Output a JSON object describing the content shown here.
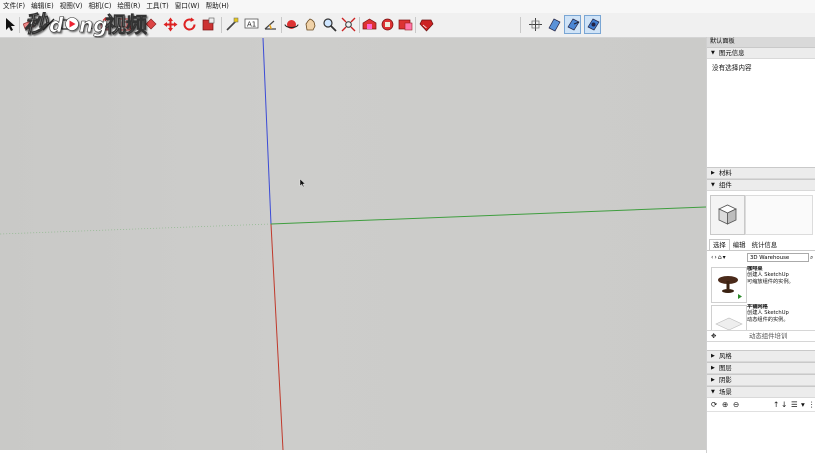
{
  "menu": [
    "文件(F)",
    "编辑(E)",
    "视图(V)",
    "相机(C)",
    "绘图(R)",
    "工具(T)",
    "窗口(W)",
    "帮助(H)"
  ],
  "watermark": "秒懂视频",
  "toolbar": {
    "icons": [
      "select-tool-icon",
      "eraser-icon",
      "line-tool-icon",
      "rectangle-tool-icon",
      "arc-tool-icon",
      "push-pull-icon",
      "move-tool-icon",
      "rotate-tool-icon",
      "offset-tool-icon",
      "tape-measure-icon",
      "text-tool-icon",
      "protractor-icon",
      "paint-bucket-icon",
      "orbit-icon",
      "pan-icon",
      "zoom-icon",
      "zoom-extents-icon",
      "warehouse-icon",
      "share-model-icon",
      "extension-warehouse-icon",
      "ruby-console-icon",
      "section-plane-icon",
      "display-section-planes-icon",
      "display-section-cuts-icon",
      "section-fill-icon"
    ]
  },
  "tray": {
    "title": "默认面板",
    "entity_info": {
      "header": "图元信息",
      "text": "没有选择内容"
    },
    "materials": {
      "header": "材料"
    },
    "components": {
      "header": "组件",
      "tabs": [
        "选择",
        "编辑",
        "统计信息"
      ],
      "search_value": "3D Warehouse",
      "results": [
        {
          "title": "咖啡桌",
          "line1": "创建人 SketchUp",
          "line2": "可缩放组件的实例。"
        },
        {
          "title": "平铺网格",
          "line1": "创建人 SketchUp",
          "line2": "动态组件的实例。"
        }
      ],
      "status": "动态组件培训"
    },
    "styles": {
      "header": "风格"
    },
    "layers": {
      "header": "图层"
    },
    "shadows": {
      "header": "阴影"
    },
    "scenes": {
      "header": "场景"
    }
  },
  "colors": {
    "axis_red": "#c0392b",
    "axis_green": "#3f9e3f",
    "axis_blue": "#3b4bd6",
    "viewport_bg": "#cbcbc9"
  }
}
